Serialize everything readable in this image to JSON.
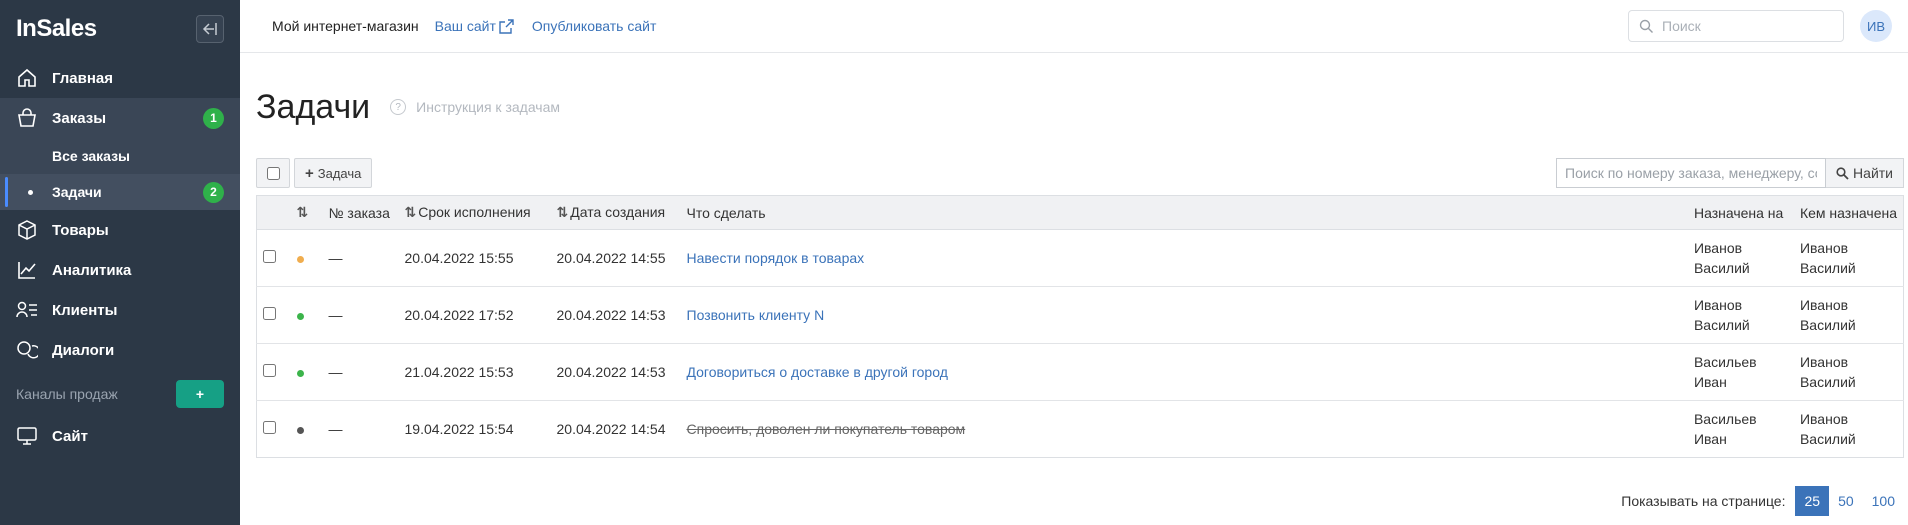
{
  "sidebar": {
    "logo": "InSales",
    "nav": {
      "home": "Главная",
      "orders": "Заказы",
      "orders_badge": "1",
      "all_orders": "Все заказы",
      "tasks": "Задачи",
      "tasks_badge": "2",
      "products": "Товары",
      "analytics": "Аналитика",
      "clients": "Клиенты",
      "dialogs": "Диалоги"
    },
    "channels_label": "Каналы продаж",
    "add_channel": "+",
    "site": "Сайт"
  },
  "topbar": {
    "shop_name": "Мой интернет-магазин",
    "your_site": "Ваш сайт",
    "publish": "Опубликовать сайт",
    "search_placeholder": "Поиск",
    "avatar": "ИВ"
  },
  "page": {
    "title": "Задачи",
    "help": "Инструкция к задачам",
    "help_icon": "?",
    "add_task": "Задача",
    "task_search_placeholder": "Поиск по номеру заказа, менеджеру, содержимому",
    "find": "Найти"
  },
  "table": {
    "headers": {
      "sort": "⇅",
      "order_no": "№ заказа",
      "deadline": "Срок исполнения",
      "created": "Дата создания",
      "what": "Что сделать",
      "assigned_to": "Назначена на",
      "assigned_by": "Кем назначена"
    },
    "rows": [
      {
        "status_color": "#f0ad4e",
        "order": "—",
        "deadline": "20.04.2022 15:55",
        "created": "20.04.2022 14:55",
        "task": "Навести порядок в товарах",
        "to1": "Иванов",
        "to2": "Василий",
        "by1": "Иванов",
        "by2": "Василий"
      },
      {
        "status_color": "#3cb44b",
        "order": "—",
        "deadline": "20.04.2022 17:52",
        "created": "20.04.2022 14:53",
        "task": "Позвонить клиенту N",
        "to1": "Иванов",
        "to2": "Василий",
        "by1": "Иванов",
        "by2": "Василий"
      },
      {
        "status_color": "#3cb44b",
        "order": "—",
        "deadline": "21.04.2022 15:53",
        "created": "20.04.2022 14:53",
        "task": "Договориться о доставке в другой город",
        "to1": "Васильев",
        "to2": "Иван",
        "by1": "Иванов",
        "by2": "Василий"
      },
      {
        "status_color": "#555555",
        "order": "—",
        "deadline": "19.04.2022 15:54",
        "created": "20.04.2022 14:54",
        "task": "Спросить, доволен ли покупатель товаром",
        "to1": "Васильев",
        "to2": "Иван",
        "by1": "Иванов",
        "by2": "Василий"
      }
    ]
  },
  "pager": {
    "label": "Показывать на странице:",
    "opt1": "25",
    "opt2": "50",
    "opt3": "100"
  }
}
